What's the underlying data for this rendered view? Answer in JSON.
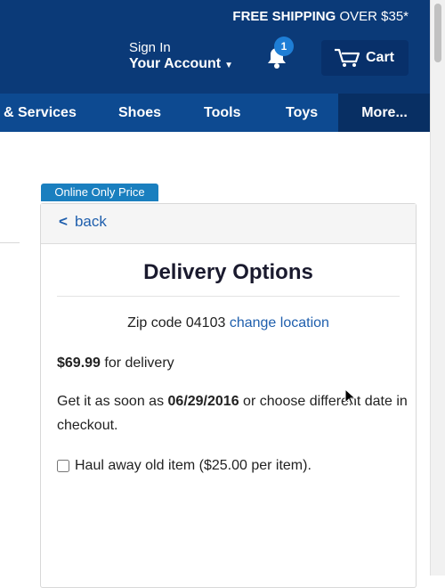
{
  "header": {
    "promo_bold": "FREE SHIPPING",
    "promo_rest": "OVER $35*",
    "account_line1": "Sign In",
    "account_line2": "Your Account",
    "notification_count": "1",
    "cart_label": "Cart"
  },
  "nav": {
    "items": [
      "& Services",
      "Shoes",
      "Tools",
      "Toys",
      "More..."
    ]
  },
  "card": {
    "badge": "Online Only Price",
    "back_label": "back",
    "title": "Delivery Options",
    "zip_prefix": "Zip code 04103",
    "change_location": "change location",
    "price": "$69.99",
    "price_suffix": "for delivery",
    "soon_prefix": "Get it as soon as",
    "soon_date": "06/29/2016",
    "soon_suffix": "or choose different date in checkout.",
    "haul_label": "Haul away old item ($25.00 per item)."
  },
  "colors": {
    "header_bg": "#0b3a78",
    "nav_bg": "#0d4a91",
    "link": "#1f5fad",
    "badge_bg": "#1a7fbf"
  }
}
